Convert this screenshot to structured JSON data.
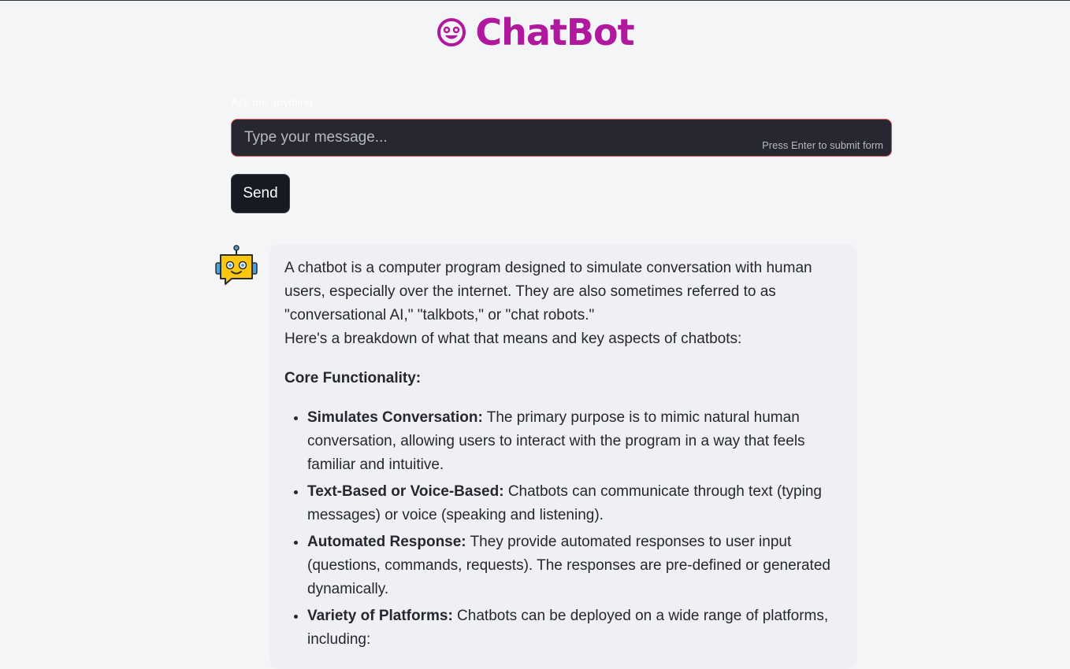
{
  "app": {
    "title": "ChatBot",
    "accent_color": "#b0199e",
    "logo_icon": "smiling-face-icon"
  },
  "form": {
    "label": "Ask me anything",
    "placeholder": "Type your message...",
    "value": "",
    "hint": "Press Enter to submit form",
    "send_label": "Send"
  },
  "chat": {
    "avatar_icon": "robot-icon",
    "message": {
      "intro_lines": [
        "A chatbot is a computer program designed to simulate conversation with human users, especially over the internet. They are also sometimes referred to as \"conversational AI,\" \"talkbots,\" or \"chat robots.\"",
        "Here's a breakdown of what that means and key aspects of chatbots:"
      ],
      "section_heading": "Core Functionality:",
      "items": [
        {
          "term": "Simulates Conversation:",
          "text": " The primary purpose is to mimic natural human conversation, allowing users to interact with the program in a way that feels familiar and intuitive."
        },
        {
          "term": "Text-Based or Voice-Based:",
          "text": " Chatbots can communicate through text (typing messages) or voice (speaking and listening)."
        },
        {
          "term": "Automated Response:",
          "text": " They provide automated responses to user input (questions, commands, requests). The responses are pre-defined or generated dynamically."
        },
        {
          "term": "Variety of Platforms:",
          "text": " Chatbots can be deployed on a wide range of platforms, including:"
        }
      ]
    }
  }
}
